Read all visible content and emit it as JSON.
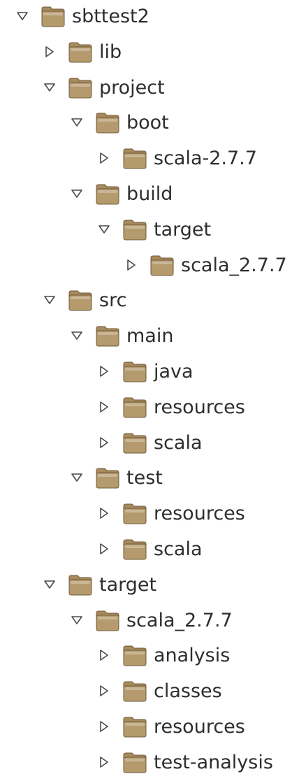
{
  "tree": {
    "items": [
      {
        "label": "sbttest2",
        "depth": 0,
        "expanded": true
      },
      {
        "label": "lib",
        "depth": 1,
        "expanded": false
      },
      {
        "label": "project",
        "depth": 1,
        "expanded": true
      },
      {
        "label": "boot",
        "depth": 2,
        "expanded": true
      },
      {
        "label": "scala-2.7.7",
        "depth": 3,
        "expanded": false
      },
      {
        "label": "build",
        "depth": 2,
        "expanded": true
      },
      {
        "label": "target",
        "depth": 3,
        "expanded": true
      },
      {
        "label": "scala_2.7.7",
        "depth": 4,
        "expanded": false
      },
      {
        "label": "src",
        "depth": 1,
        "expanded": true
      },
      {
        "label": "main",
        "depth": 2,
        "expanded": true
      },
      {
        "label": "java",
        "depth": 3,
        "expanded": false
      },
      {
        "label": "resources",
        "depth": 3,
        "expanded": false
      },
      {
        "label": "scala",
        "depth": 3,
        "expanded": false
      },
      {
        "label": "test",
        "depth": 2,
        "expanded": true
      },
      {
        "label": "resources",
        "depth": 3,
        "expanded": false
      },
      {
        "label": "scala",
        "depth": 3,
        "expanded": false
      },
      {
        "label": "target",
        "depth": 1,
        "expanded": true
      },
      {
        "label": "scala_2.7.7",
        "depth": 2,
        "expanded": true
      },
      {
        "label": "analysis",
        "depth": 3,
        "expanded": false
      },
      {
        "label": "classes",
        "depth": 3,
        "expanded": false
      },
      {
        "label": "resources",
        "depth": 3,
        "expanded": false
      },
      {
        "label": "test-analysis",
        "depth": 3,
        "expanded": false
      }
    ]
  },
  "icons": {
    "expanded": "triangle-down-icon",
    "collapsed": "triangle-right-icon",
    "folder": "folder-icon"
  },
  "colors": {
    "folder_body": "#b59a6e",
    "folder_tab": "#a88b5c",
    "folder_outline": "#6f5a3a",
    "twisty": "#4a4a4a",
    "text": "#2e2e2e"
  }
}
